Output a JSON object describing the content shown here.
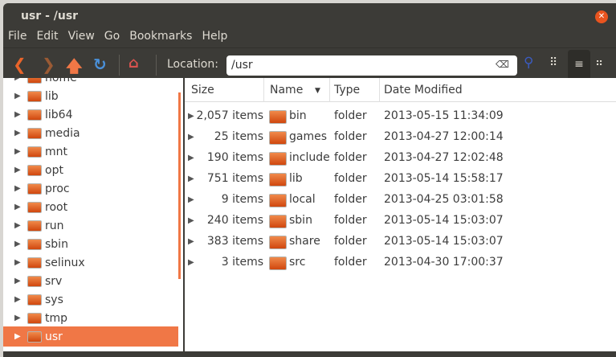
{
  "window": {
    "title": "usr - /usr"
  },
  "menu": [
    "File",
    "Edit",
    "View",
    "Go",
    "Bookmarks",
    "Help"
  ],
  "toolbar": {
    "location_label": "Location:",
    "location_value": "/usr"
  },
  "sidebar": {
    "items": [
      {
        "label": "home"
      },
      {
        "label": "lib"
      },
      {
        "label": "lib64"
      },
      {
        "label": "media"
      },
      {
        "label": "mnt"
      },
      {
        "label": "opt"
      },
      {
        "label": "proc"
      },
      {
        "label": "root"
      },
      {
        "label": "run"
      },
      {
        "label": "sbin"
      },
      {
        "label": "selinux"
      },
      {
        "label": "srv"
      },
      {
        "label": "sys"
      },
      {
        "label": "tmp"
      },
      {
        "label": "usr",
        "selected": true
      }
    ]
  },
  "columns": {
    "size": "Size",
    "name": "Name",
    "type": "Type",
    "date": "Date Modified"
  },
  "files": [
    {
      "size": "2,057 items",
      "name": "bin",
      "type": "folder",
      "date": "2013-05-15 11:34:09"
    },
    {
      "size": "25 items",
      "name": "games",
      "type": "folder",
      "date": "2013-04-27 12:00:14"
    },
    {
      "size": "190 items",
      "name": "include",
      "type": "folder",
      "date": "2013-04-27 12:02:48"
    },
    {
      "size": "751 items",
      "name": "lib",
      "type": "folder",
      "date": "2013-05-14 15:58:17"
    },
    {
      "size": "9 items",
      "name": "local",
      "type": "folder",
      "date": "2013-04-25 03:01:58"
    },
    {
      "size": "240 items",
      "name": "sbin",
      "type": "folder",
      "date": "2013-05-14 15:03:07"
    },
    {
      "size": "383 items",
      "name": "share",
      "type": "folder",
      "date": "2013-05-14 15:03:07"
    },
    {
      "size": "3 items",
      "name": "src",
      "type": "folder",
      "date": "2013-04-30 17:00:37"
    }
  ],
  "colors": {
    "accent": "#f07746",
    "titlebar": "#3c3b37"
  }
}
